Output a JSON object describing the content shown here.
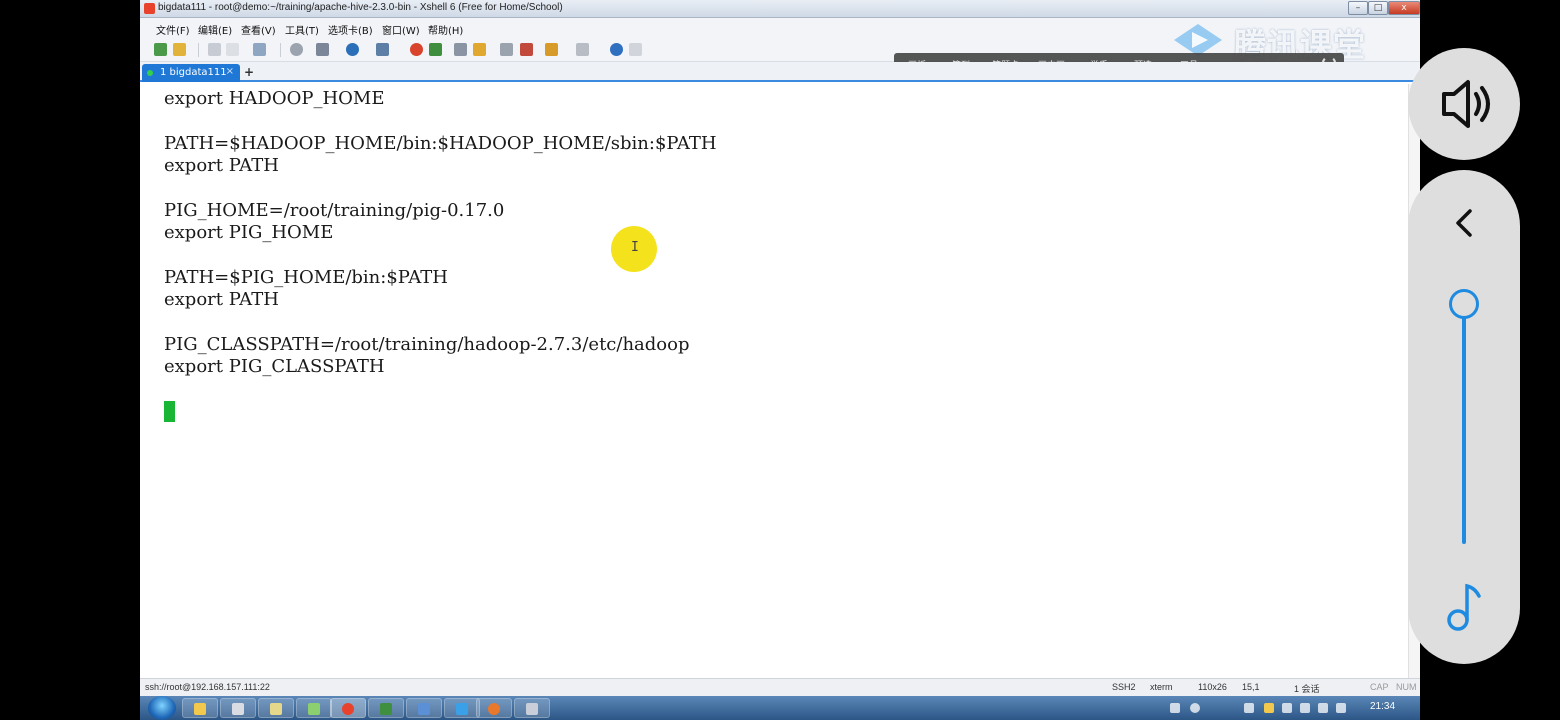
{
  "window": {
    "title": "bigdata111 - root@demo:~/training/apache-hive-2.3.0-bin - Xshell 6 (Free for Home/School)",
    "controls": [
      "–",
      "□",
      "x"
    ]
  },
  "menu": {
    "items": [
      "文件(F)",
      "编辑(E)",
      "查看(V)",
      "工具(T)",
      "选项卡(B)",
      "窗口(W)",
      "帮助(H)"
    ]
  },
  "classroom_toolbar": {
    "items": [
      "画板",
      "签到",
      "答题卡",
      "画中画",
      "举手",
      "预选",
      "工具"
    ]
  },
  "watermark": {
    "text": "腾讯课堂"
  },
  "tabs": {
    "session_label": "1 bigdata111",
    "close": "×",
    "add": "+"
  },
  "terminal": {
    "lines": [
      "export HADOOP_HOME",
      "",
      "PATH=$HADOOP_HOME/bin:$HADOOP_HOME/sbin:$PATH",
      "export PATH",
      "",
      "PIG_HOME=/root/training/pig-0.17.0",
      "export PIG_HOME",
      "",
      "PATH=$PIG_HOME/bin:$PATH",
      "export PATH",
      "",
      "PIG_CLASSPATH=/root/training/hadoop-2.7.3/etc/hadoop",
      "export PIG_CLASSPATH"
    ],
    "pointer_glyph": "I"
  },
  "status": {
    "connection": "ssh://root@192.168.157.111:22",
    "protocol": "SSH2",
    "term": "xterm",
    "size": "110x26",
    "position": "15,1",
    "sessions": "1 会话",
    "caps": "CAP",
    "num": "NUM"
  },
  "taskbar": {
    "clock": "21:34"
  },
  "colors": {
    "tab_active": "#1f77d6",
    "cursor": "#19b534",
    "pointer_highlight": "#f4e21c",
    "slider": "#1e8be0"
  },
  "icons": {
    "volume": "speaker-icon",
    "collapse": "chevron-left-icon",
    "music": "music-note-icon"
  }
}
